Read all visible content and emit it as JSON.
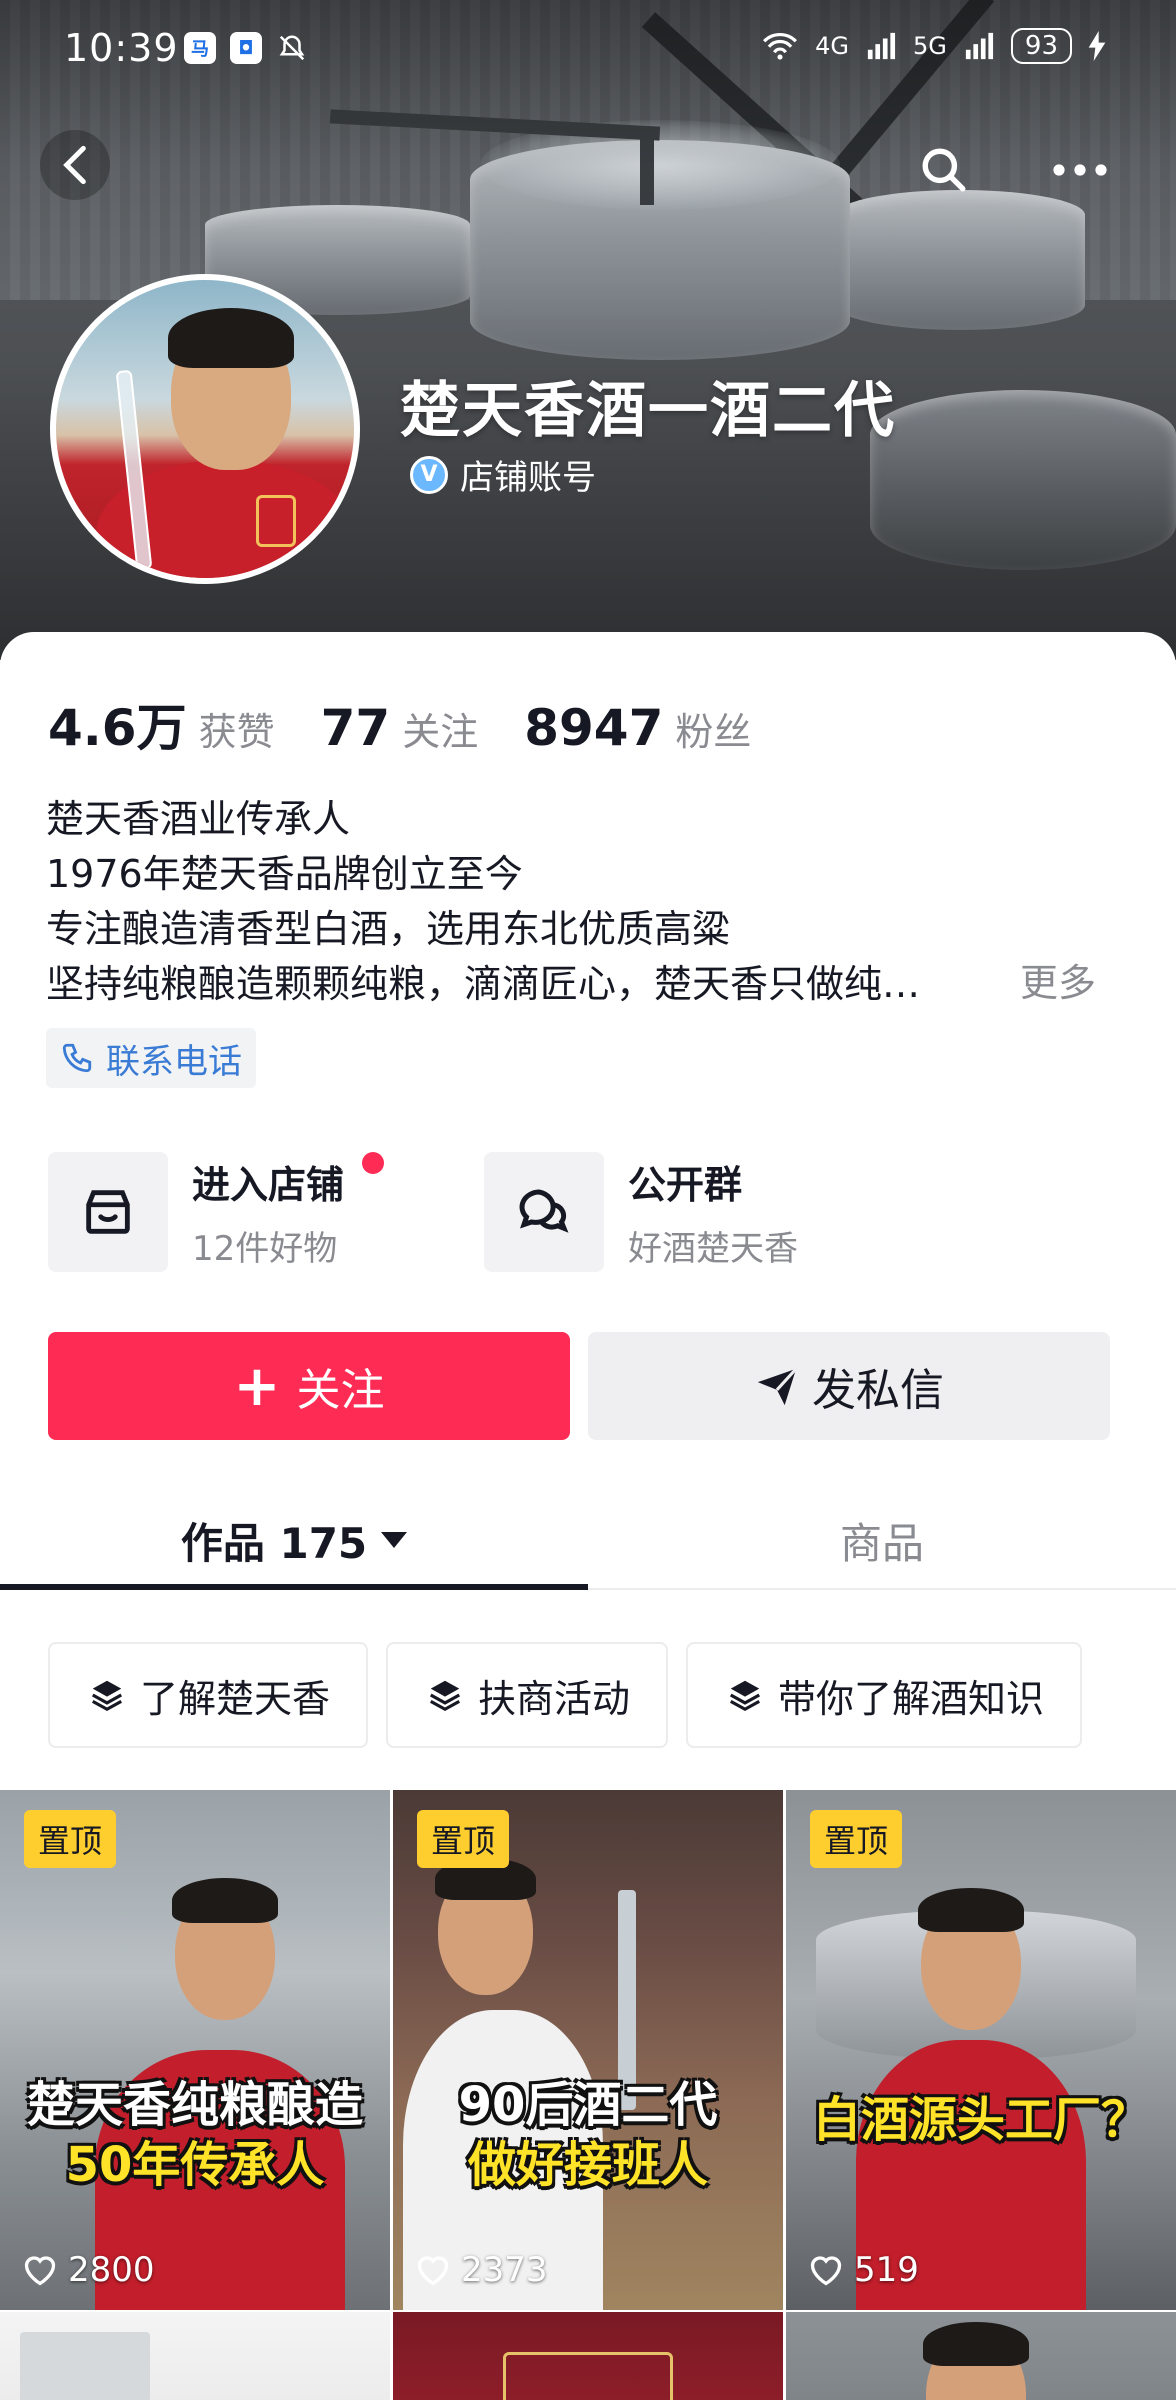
{
  "status_bar": {
    "time": "10:39",
    "left_icons": [
      "app-badge-icon",
      "app-square-icon",
      "mute-bell-icon"
    ],
    "network_1": "4G",
    "network_2": "5G",
    "battery": "93"
  },
  "header": {
    "back_icon": "chevron-left-icon",
    "search_icon": "search-icon",
    "more_icon": "more-dots-icon"
  },
  "profile": {
    "name": "楚天香酒一酒二代",
    "verify_label": "店铺账号",
    "verify_badge": "V"
  },
  "stats": [
    {
      "number": "4.6万",
      "label": "获赞"
    },
    {
      "number": "77",
      "label": "关注"
    },
    {
      "number": "8947",
      "label": "粉丝"
    }
  ],
  "bio": {
    "lines": [
      "楚天香酒业传承人",
      "1976年楚天香品牌创立至今",
      "专注酿造清香型白酒，选用东北优质高粱",
      "坚持纯粮酿造颗颗纯粮，滴滴匠心，楚天香只做纯…"
    ],
    "more": "更多"
  },
  "contact": {
    "label": "联系电话",
    "icon": "phone-icon"
  },
  "entries": [
    {
      "title": "进入店铺",
      "subtitle": "12件好物",
      "icon": "store-icon",
      "has_dot": true
    },
    {
      "title": "公开群",
      "subtitle": "好酒楚天香",
      "icon": "chat-bubbles-icon",
      "has_dot": false
    }
  ],
  "actions": {
    "follow": "关注",
    "follow_icon": "plus-icon",
    "message": "发私信",
    "message_icon": "send-icon"
  },
  "tabs": [
    {
      "label": "作品 175",
      "active": true
    },
    {
      "label": "商品",
      "active": false
    }
  ],
  "collections": [
    "了解楚天香",
    "扶商活动",
    "带你了解酒知识"
  ],
  "videos": [
    {
      "pinned": "置顶",
      "caption_line1": "楚天香纯粮酿造",
      "caption_line2": "50年传承人",
      "likes": "2800"
    },
    {
      "pinned": "置顶",
      "caption_line1": "90后酒二代",
      "caption_line2": "做好接班人",
      "likes": "2373"
    },
    {
      "pinned": "置顶",
      "caption_line1": "白酒源头工厂？",
      "caption_line2": "",
      "likes": "519"
    }
  ],
  "colors": {
    "accent": "#fe2c55",
    "pin": "#fece2f",
    "link": "#3a7bd5",
    "muted": "#8a8b91"
  }
}
